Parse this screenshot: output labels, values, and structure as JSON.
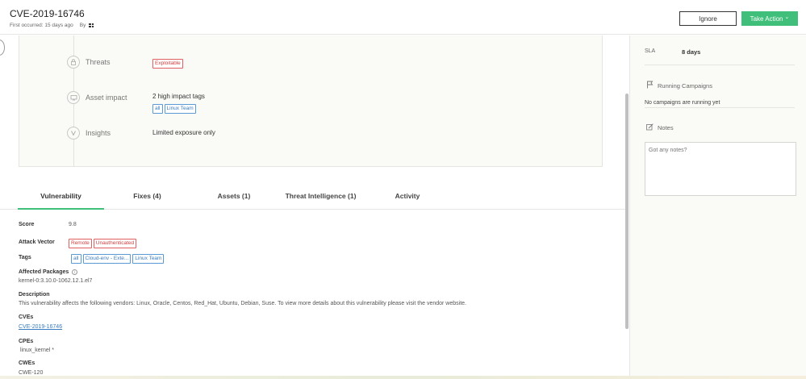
{
  "header": {
    "title": "CVE-2019-16746",
    "first_occurred": "First occurred: 15 days ago",
    "by_label": "By",
    "ignore_label": "Ignore",
    "take_action_label": "Take Action",
    "take_action_chevron": "⌄",
    "accent_color": "#3fbf7a"
  },
  "summary": {
    "threats": {
      "label": "Threats",
      "tags": [
        "Exploitable"
      ]
    },
    "asset_impact": {
      "label": "Asset impact",
      "value": "2 high impact tags",
      "tags": [
        "all",
        "Linux Team"
      ]
    },
    "insights": {
      "label": "Insights",
      "value": "Limited exposure only"
    }
  },
  "tabs": [
    {
      "label": "Vulnerability",
      "active": true
    },
    {
      "label": "Fixes (4)",
      "active": false
    },
    {
      "label": "Assets (1)",
      "active": false
    },
    {
      "label": "Threat Intelligence (1)",
      "active": false
    },
    {
      "label": "Activity",
      "active": false
    }
  ],
  "details": {
    "score_label": "Score",
    "score_value": "9.8",
    "attack_vector_label": "Attack Vector",
    "attack_vector_tags": [
      "Remote",
      "Unauthenticated"
    ],
    "tags_label": "Tags",
    "tags": [
      "all",
      "Cloud-env - Exte...",
      "Linux Team"
    ],
    "affected_packages_label": "Affected Packages",
    "affected_packages_value": "kernel-0:3.10.0-1062.12.1.el7",
    "description_label": "Description",
    "description_value": "This vulnerability affects the following vendors: Linux, Oracle, Centos, Red_Hat, Ubuntu, Debian, Suse. To view more details about this vulnerability please visit the vendor website.",
    "cves_label": "CVEs",
    "cves_value": "CVE-2019-16746",
    "cpes_label": "CPEs",
    "cpes_value": "linux_kernel *",
    "cwes_label": "CWEs",
    "cwes_value": "CWE-120"
  },
  "sidebar": {
    "sla_label": "SLA",
    "sla_value": "8 days",
    "running_campaigns_label": "Running Campaigns",
    "no_campaigns_text": "No campaigns are running yet",
    "notes_label": "Notes",
    "notes_placeholder": "Got any notes?"
  }
}
